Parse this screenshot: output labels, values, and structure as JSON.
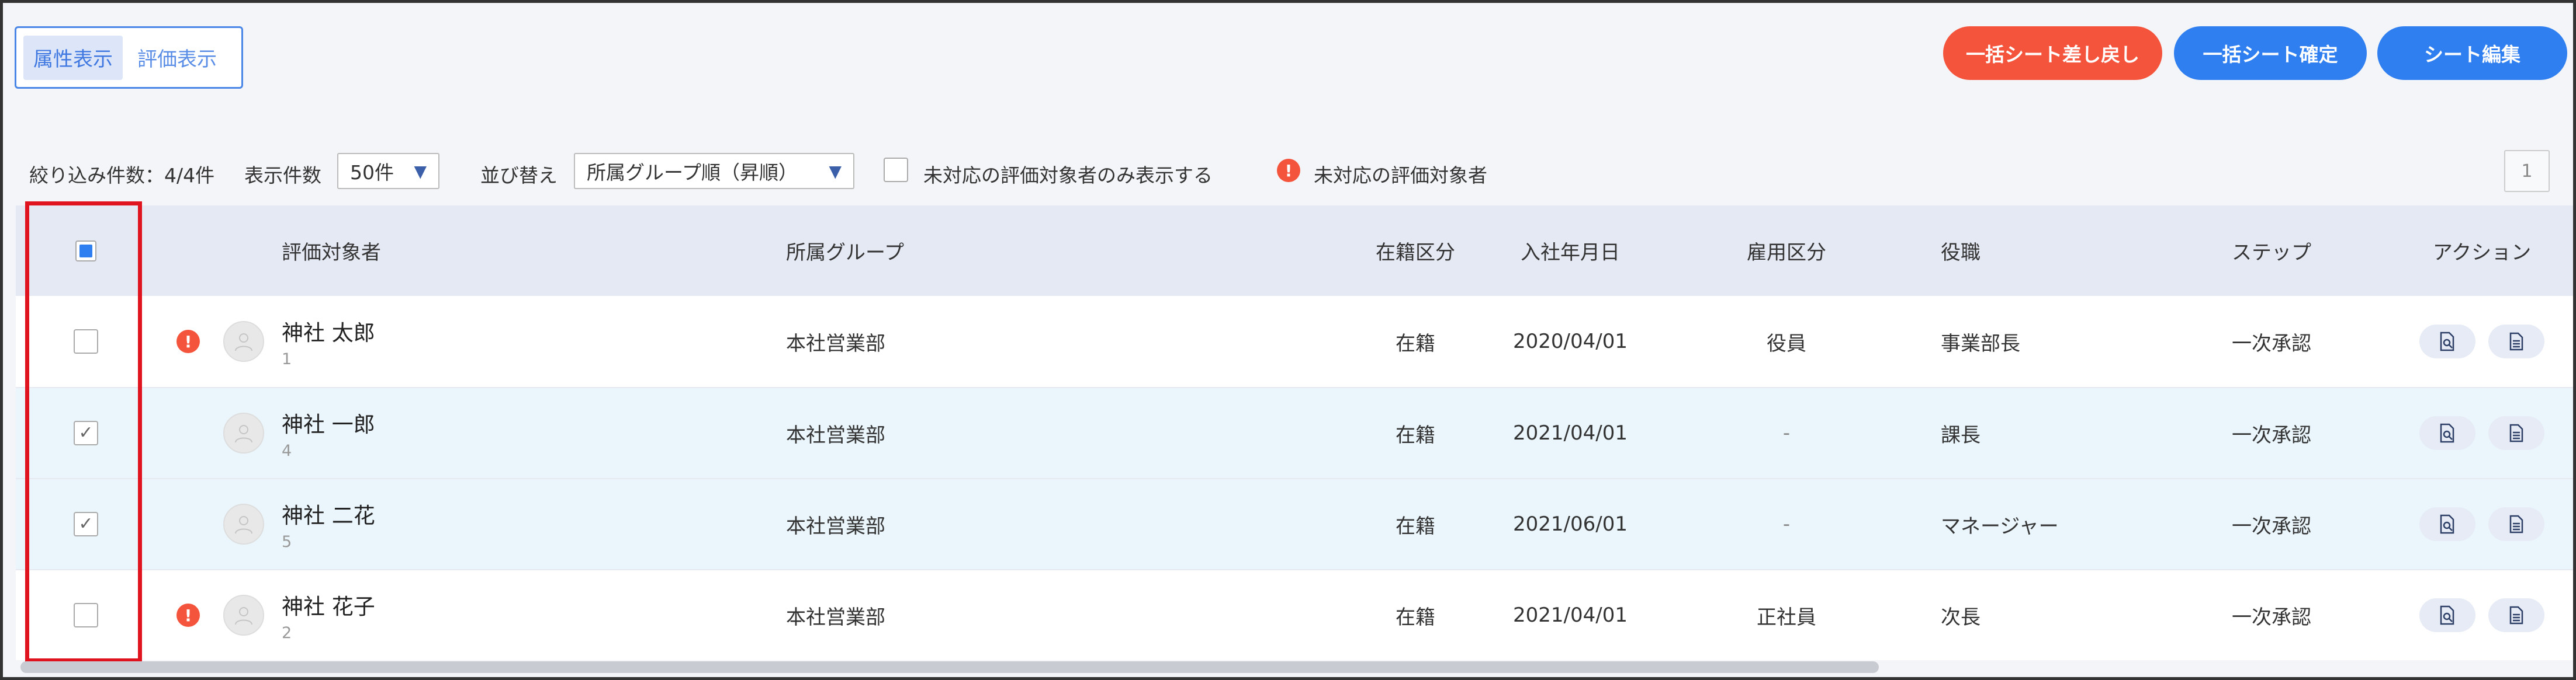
{
  "view_toggle": {
    "attribute_tab": "属性表示",
    "evaluation_tab": "評価表示"
  },
  "header_buttons": {
    "revert": "一括シート差し戻し",
    "confirm": "一括シート確定",
    "edit": "シート編集"
  },
  "colors": {
    "red": "#f5543c",
    "blue": "#2f7ff0",
    "highlight": "#e0141e"
  },
  "filter_bar": {
    "count_label": "絞り込み件数：4/4件",
    "per_page_label": "表示件数",
    "per_page_value": "50件",
    "sort_label": "並び替え",
    "sort_value": "所属グループ順（昇順）",
    "unhandled_only_label": "未対応の評価対象者のみ表示する",
    "unhandled_legend": "未対応の評価対象者",
    "page_number": "1"
  },
  "table": {
    "headers": {
      "target": "評価対象者",
      "group": "所属グループ",
      "status": "在籍区分",
      "join_date": "入社年月日",
      "employment": "雇用区分",
      "role": "役職",
      "step": "ステップ",
      "action": "アクション"
    },
    "rows": [
      {
        "checked": false,
        "alert": true,
        "name": "神社 太郎",
        "id": "1",
        "group": "本社営業部",
        "status": "在籍",
        "join_date": "2020/04/01",
        "employment": "役員",
        "role": "事業部長",
        "step": "一次承認"
      },
      {
        "checked": true,
        "alert": false,
        "name": "神社 一郎",
        "id": "4",
        "group": "本社営業部",
        "status": "在籍",
        "join_date": "2021/04/01",
        "employment": "-",
        "role": "課長",
        "step": "一次承認"
      },
      {
        "checked": true,
        "alert": false,
        "name": "神社 二花",
        "id": "5",
        "group": "本社営業部",
        "status": "在籍",
        "join_date": "2021/06/01",
        "employment": "-",
        "role": "マネージャー",
        "step": "一次承認"
      },
      {
        "checked": false,
        "alert": true,
        "name": "神社 花子",
        "id": "2",
        "group": "本社営業部",
        "status": "在籍",
        "join_date": "2021/04/01",
        "employment": "正社員",
        "role": "次長",
        "step": "一次承認"
      }
    ]
  }
}
